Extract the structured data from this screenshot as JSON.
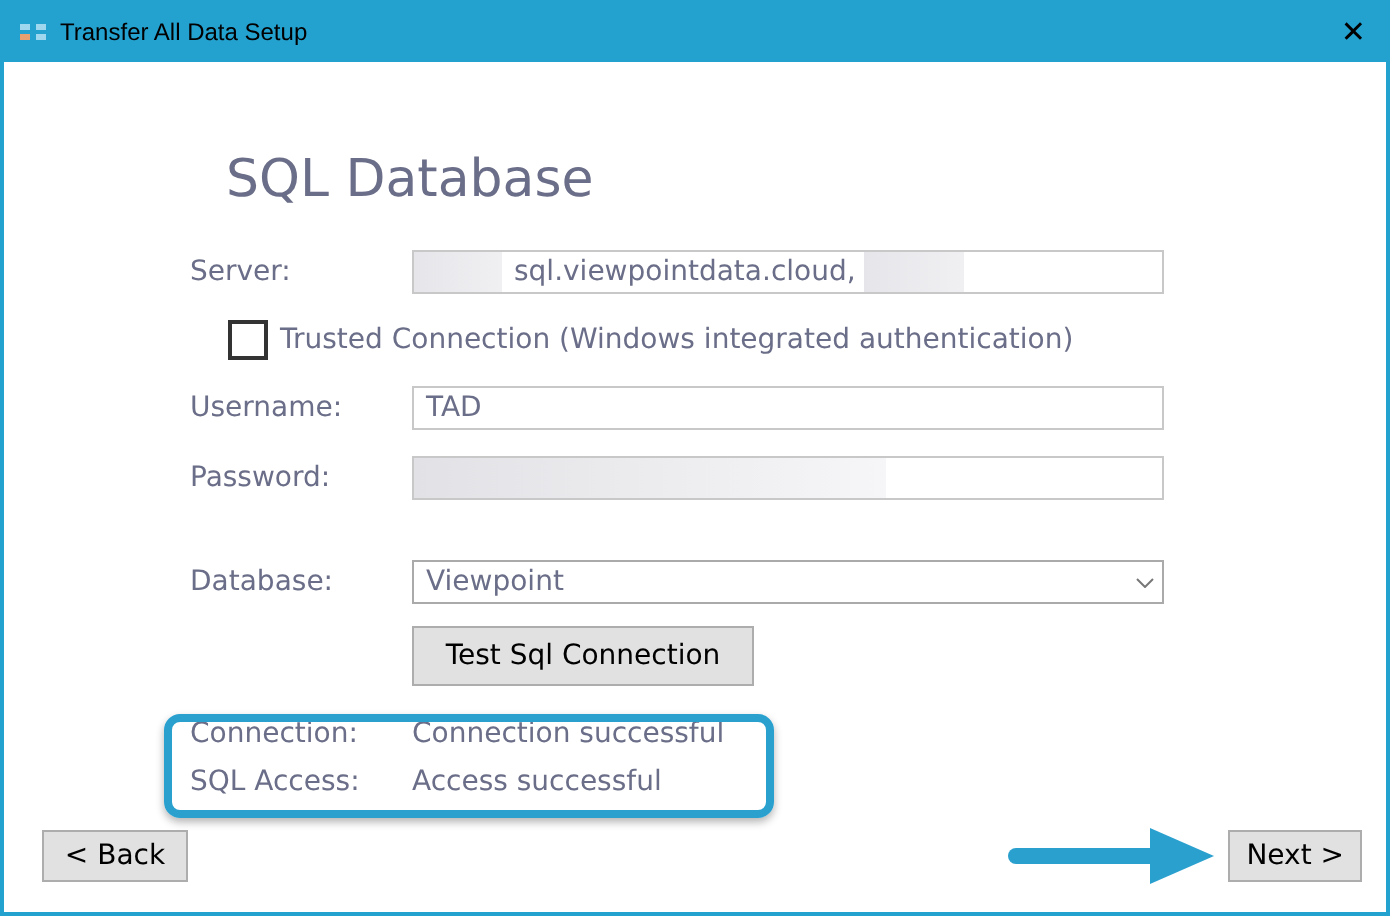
{
  "window": {
    "title": "Transfer All Data Setup",
    "close": "✕"
  },
  "heading": "SQL Database",
  "fields": [
    {
      "kind": "text",
      "label": "Server:",
      "value": "sql.viewpointdata.cloud,"
    },
    {
      "kind": "checkbox",
      "label": "Trusted Connection (Windows integrated authentication)",
      "checked": false
    },
    {
      "kind": "text",
      "label": "Username:",
      "value": "TAD"
    },
    {
      "kind": "password",
      "label": "Password:"
    },
    {
      "kind": "select",
      "label": "Database:",
      "value": "Viewpoint"
    }
  ],
  "test_button": "Test Sql Connection",
  "results": [
    {
      "label": "Connection:",
      "value": "Connection successful"
    },
    {
      "label": "SQL Access:",
      "value": "Access successful"
    }
  ],
  "buttons": {
    "back": "<  Back",
    "next": "Next >"
  }
}
